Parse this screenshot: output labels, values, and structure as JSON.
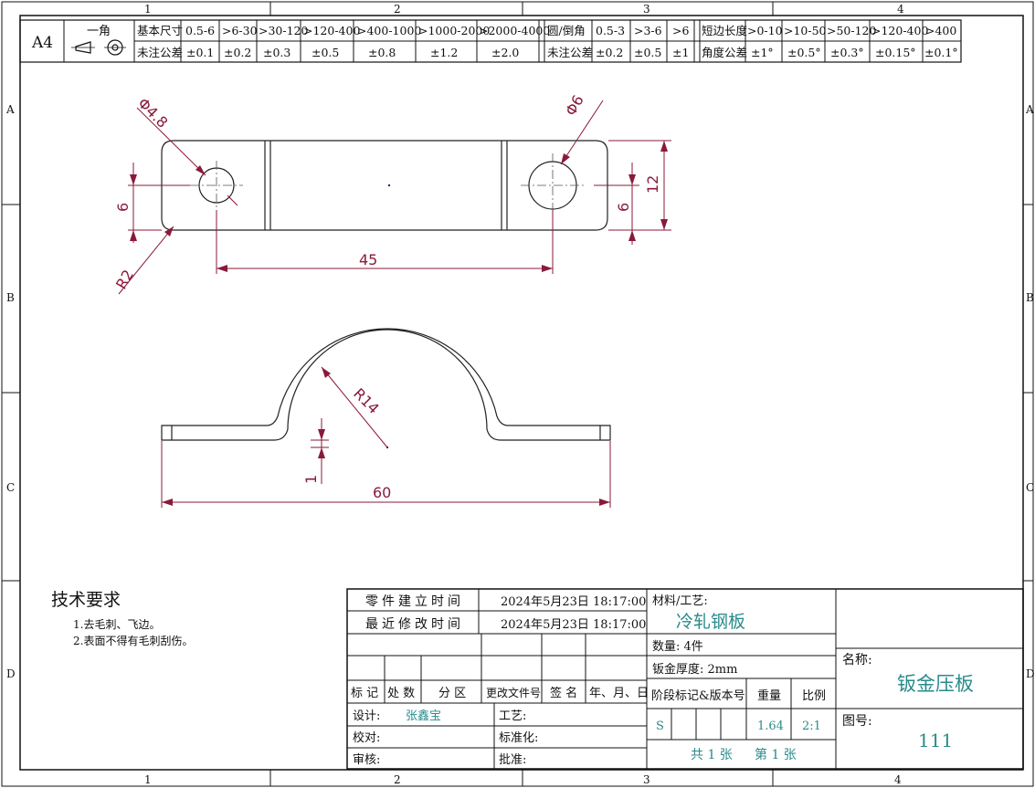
{
  "border_zones": {
    "columns": [
      "1",
      "2",
      "3",
      "4"
    ],
    "rows": [
      "A",
      "B",
      "C",
      "D"
    ]
  },
  "tolerance_table": {
    "sheet_size": "A4",
    "projection_label": "一角",
    "basic_size_label": "基本尺寸",
    "unnoted_tol_label": "未注公差",
    "size_ranges": [
      "0.5-6",
      ">6-30",
      ">30-120",
      ">120-400",
      ">400-1000",
      ">1000-2000",
      ">2000-4000"
    ],
    "size_tols": [
      "±0.1",
      "±0.2",
      "±0.3",
      "±0.5",
      "±0.8",
      "±1.2",
      "±2.0"
    ],
    "fillet_label": "圆/倒角",
    "fillet_tol_label": "未注公差",
    "fillet_ranges": [
      "0.5-3",
      ">3-6",
      ">6"
    ],
    "fillet_tols": [
      "±0.2",
      "±0.5",
      "±1"
    ],
    "short_edge_label": "短边长度",
    "angle_tol_label": "角度公差",
    "angle_ranges": [
      ">0-10",
      ">10-50",
      ">50-120",
      ">120-400",
      ">400"
    ],
    "angle_tols": [
      "±1°",
      "±0.5°",
      "±0.3°",
      "±0.15°",
      "±0.1°"
    ]
  },
  "dimensions": {
    "hole_left": "Φ4.8",
    "hole_right": "Φ6",
    "width": "12",
    "edge_left": "6",
    "edge_right": "6",
    "hole_spacing": "45",
    "corner_radius": "R2",
    "arc_radius": "R14",
    "thickness": "1",
    "overall_length": "60"
  },
  "tech_requirements": {
    "title": "技术要求",
    "items": [
      "1.去毛刺、飞边。",
      "2.表面不得有毛刺刮伤。"
    ]
  },
  "title_block": {
    "created_label": "零件建立时间",
    "created_value": "2024年5月23日 18:17:00",
    "modified_label": "最近修改时间",
    "modified_value": "2024年5月23日 18:17:00",
    "rev_headers": [
      "标 记",
      "处 数",
      "分 区",
      "更改文件号",
      "签 名",
      "年、月、日"
    ],
    "design_label": "设计:",
    "designer": "张鑫宝",
    "craft_label": "工艺:",
    "check_label": "校对:",
    "standard_label": "标准化:",
    "review_label": "审核:",
    "approve_label": "批准:",
    "material_label": "材料/工艺:",
    "material_value": "冷轧钢板",
    "quantity": "数量: 4件",
    "thickness": "钣金厚度: 2mm",
    "stage_label": "阶段标记&版本号",
    "weight_label": "重量",
    "scale_label": "比例",
    "stage_value": "S",
    "weight_value": "1.64",
    "scale_value": "2:1",
    "total_sheets": "共 1 张",
    "sheet_no": "第 1 张",
    "name_label": "名称:",
    "name_value": "钣金压板",
    "drawing_no_label": "图号:",
    "drawing_no_value": "111"
  }
}
